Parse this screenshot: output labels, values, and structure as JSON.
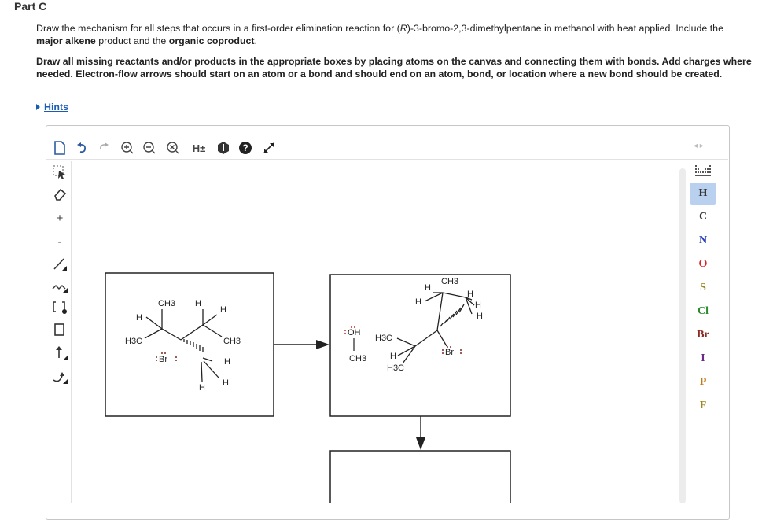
{
  "part_title": "Part C",
  "question": {
    "prefix": "Draw the mechanism for all steps that occurs in a first-order elimination reaction for (",
    "stereo": "R",
    "middle": ")-3-bromo-2,3-dimethylpentane in methanol with heat applied. Include the",
    "bold1": "major alkene",
    "middle2": " product and the ",
    "bold2": "organic coproduct",
    "end": "."
  },
  "instruction": "Draw all missing reactants and/or products in the appropriate boxes by placing atoms on the canvas and connecting them with bonds. Add charges where needed. Electron-flow arrows should start on an atom or a bond and should end on an atom, bond, or location where a new bond should be created.",
  "hints_label": "Hints",
  "toolbar": {
    "h_toggle": "H±",
    "plus": "+",
    "minus": "-"
  },
  "periodic": [
    "H",
    "C",
    "N",
    "O",
    "S",
    "Cl",
    "Br",
    "I",
    "P",
    "F"
  ],
  "periodic_colors": {
    "H": "#333333",
    "C": "#333333",
    "N": "#2b3fb5",
    "O": "#d2262a",
    "S": "#a0861a",
    "Cl": "#2b8a2b",
    "Br": "#8b2b22",
    "I": "#6d2b88",
    "P": "#c07a12",
    "F": "#a0861a"
  },
  "selected_element": "H",
  "molecule1": {
    "labels": [
      "CH3",
      "H",
      "H",
      "H",
      "H3C",
      "CH3",
      "Br",
      "H",
      "H",
      "H"
    ]
  },
  "molecule2": {
    "methanol": [
      "OH",
      "CH3"
    ],
    "labels": [
      "CH3",
      "H",
      "H",
      "H",
      "H",
      "H3C",
      "H",
      "H3C",
      "Br"
    ]
  }
}
